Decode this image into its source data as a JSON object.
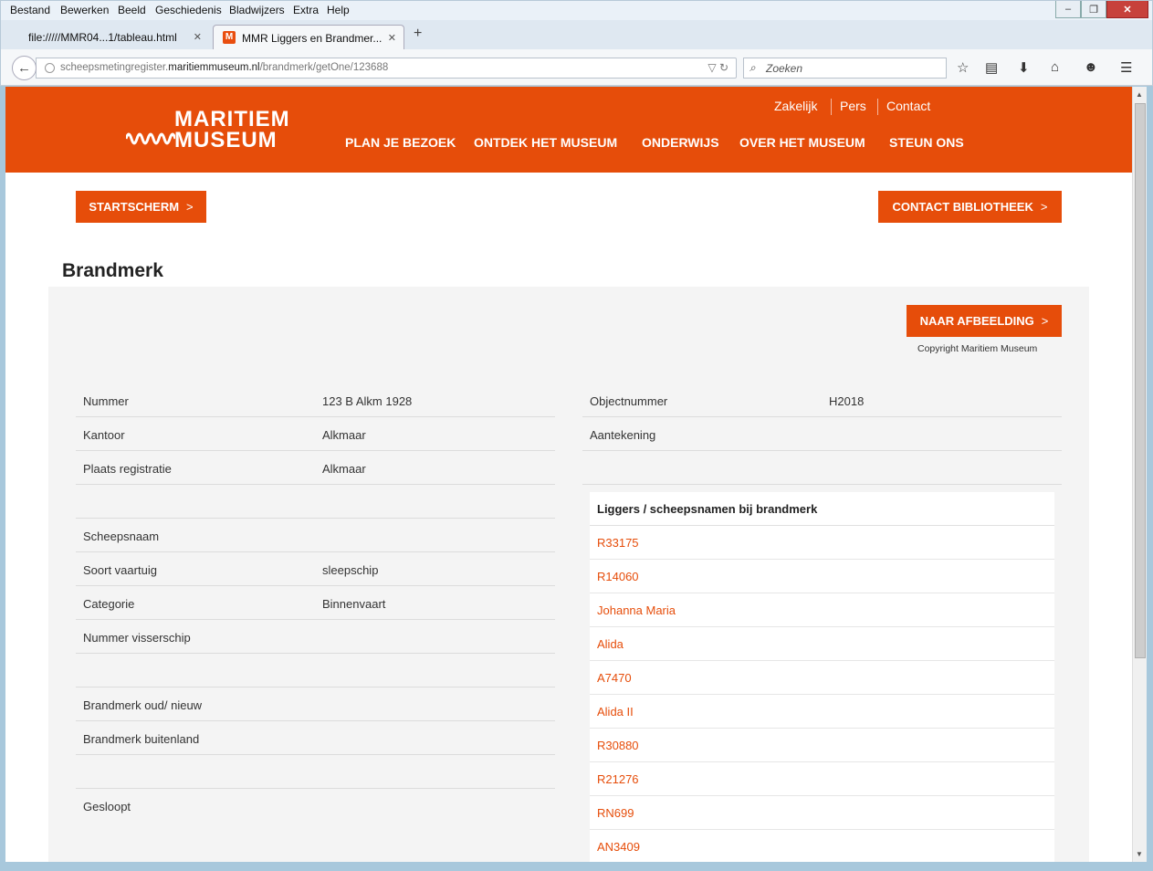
{
  "browser": {
    "menu": [
      "Bestand",
      "Bewerken",
      "Beeld",
      "Geschiedenis",
      "Bladwijzers",
      "Extra",
      "Help"
    ],
    "tabs": [
      {
        "title": "file://///MMR04...1/tableau.html"
      },
      {
        "title": "MMR Liggers en Brandmer..."
      }
    ],
    "favicon_letter": "M",
    "url_prefix": "scheepsmetingregister.",
    "url_domain": "maritiemmuseum.nl",
    "url_path": "/brandmerk/getOne/123688",
    "search_placeholder": "Zoeken",
    "window_buttons": [
      "–",
      "❐",
      "✕"
    ]
  },
  "site": {
    "logo_line1": "MARITIEM",
    "logo_line2": "MUSEUM",
    "top_links": [
      "Zakelijk",
      "Pers",
      "Contact"
    ],
    "main_nav": [
      "PLAN JE BEZOEK",
      "ONTDEK HET MUSEUM",
      "ONDERWIJS",
      "OVER HET MUSEUM",
      "STEUN ONS"
    ],
    "brand_color": "#e64d0a"
  },
  "buttons": {
    "start": "STARTSCHERM",
    "contact": "CONTACT BIBLIOTHEEK",
    "image": "NAAR AFBEELDING",
    "chevron": ">"
  },
  "page": {
    "title": "Brandmerk",
    "copyright": "Copyright Maritiem Museum"
  },
  "left_fields": [
    {
      "label": "Nummer",
      "value": "123 B Alkm 1928"
    },
    {
      "label": "Kantoor",
      "value": "Alkmaar"
    },
    {
      "label": "Plaats registratie",
      "value": "Alkmaar"
    },
    {
      "label": "",
      "value": ""
    },
    {
      "label": "Scheepsnaam",
      "value": ""
    },
    {
      "label": "Soort vaartuig",
      "value": "sleepschip"
    },
    {
      "label": "Categorie",
      "value": "Binnenvaart"
    },
    {
      "label": "Nummer visserschip",
      "value": ""
    },
    {
      "label": "",
      "value": ""
    },
    {
      "label": "Brandmerk oud/ nieuw",
      "value": ""
    },
    {
      "label": "Brandmerk buitenland",
      "value": ""
    },
    {
      "label": "",
      "value": ""
    },
    {
      "label": "Gesloopt",
      "value": ""
    }
  ],
  "right_fields": [
    {
      "label": "Objectnummer",
      "value": "H2018"
    },
    {
      "label": "Aantekening",
      "value": ""
    },
    {
      "label": "",
      "value": ""
    }
  ],
  "liggers": {
    "heading": "Liggers / scheepsnamen bij brandmerk",
    "items": [
      "R33175",
      "R14060",
      "Johanna Maria",
      "Alida",
      "A7470",
      "Alida II",
      "R30880",
      "R21276",
      "RN699",
      "AN3409"
    ]
  }
}
